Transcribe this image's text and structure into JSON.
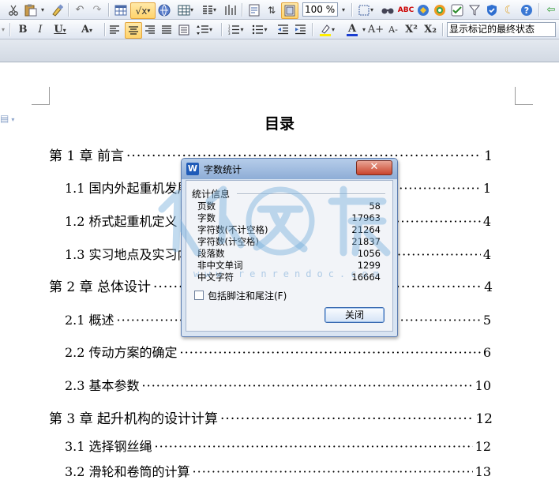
{
  "toolbar": {
    "zoom_value": "100 %",
    "markup_display": "显示标记的最终状态",
    "icons": [
      "cut-icon",
      "paste-icon",
      "format-painter-icon",
      "undo-icon",
      "redo-icon",
      "table-icon",
      "formula-icon",
      "hyperlink-icon",
      "insert-table-icon",
      "columns-icon",
      "paragraph-marks-icon",
      "insert-comment-icon",
      "sort-icon",
      "document-map-icon",
      "select-objects-icon",
      "find-icon",
      "spell-check-icon",
      "translate-icon",
      "browser-icon",
      "review-icon",
      "filter-icon",
      "shield-icon",
      "night-mode-icon",
      "help-icon",
      "back-icon"
    ],
    "format": {
      "bold": "B",
      "italic": "I",
      "underline": "U",
      "char_border": "A",
      "font_color": "A",
      "grow_font": "A+",
      "shrink_font": "A-",
      "superscript": "X²",
      "subscript": "X₂"
    }
  },
  "document": {
    "title": "目录",
    "toc": [
      {
        "label": "第 1 章  前言",
        "page": "1",
        "level": 1
      },
      {
        "label": "1.1  国内外起重机发展",
        "page": "1",
        "level": 2
      },
      {
        "label": "1.2  桥式起重机定义",
        "page": "4",
        "level": 2
      },
      {
        "label": "1.3  实习地点及实习内容",
        "page": "4",
        "level": 2
      },
      {
        "label": "第 2 章  总体设计",
        "page": "4",
        "level": 1
      },
      {
        "label": "2.1  概述",
        "page": "5",
        "level": 2
      },
      {
        "label": "2.2  传动方案的确定",
        "page": "6",
        "level": 2
      },
      {
        "label": "2.3  基本参数",
        "page": "10",
        "level": 2
      },
      {
        "label": "第 3 章  起升机构的设计计算",
        "page": "12",
        "level": 1
      },
      {
        "label": "3.1  选择钢丝绳",
        "page": "12",
        "level": 2
      },
      {
        "label": "3.2  滑轮和卷筒的计算",
        "page": "13",
        "level": 2
      }
    ]
  },
  "dialog": {
    "title": "字数统计",
    "close_glyph": "✕",
    "group_label": "统计信息",
    "stats": [
      {
        "key": "页数",
        "value": "58"
      },
      {
        "key": "字数",
        "value": "17963"
      },
      {
        "key": "字符数(不计空格)",
        "value": "21264"
      },
      {
        "key": "字符数(计空格)",
        "value": "21837"
      },
      {
        "key": "段落数",
        "value": "1056"
      },
      {
        "key": "非中文单词",
        "value": "1299"
      },
      {
        "key": "中文字符",
        "value": "16664"
      }
    ],
    "checkbox_label": "包括脚注和尾注(F)",
    "checkbox_checked": false,
    "ok_label": "关闭"
  },
  "watermark": {
    "text": "www.renrendoc.com",
    "glyphs": "人人文库"
  }
}
